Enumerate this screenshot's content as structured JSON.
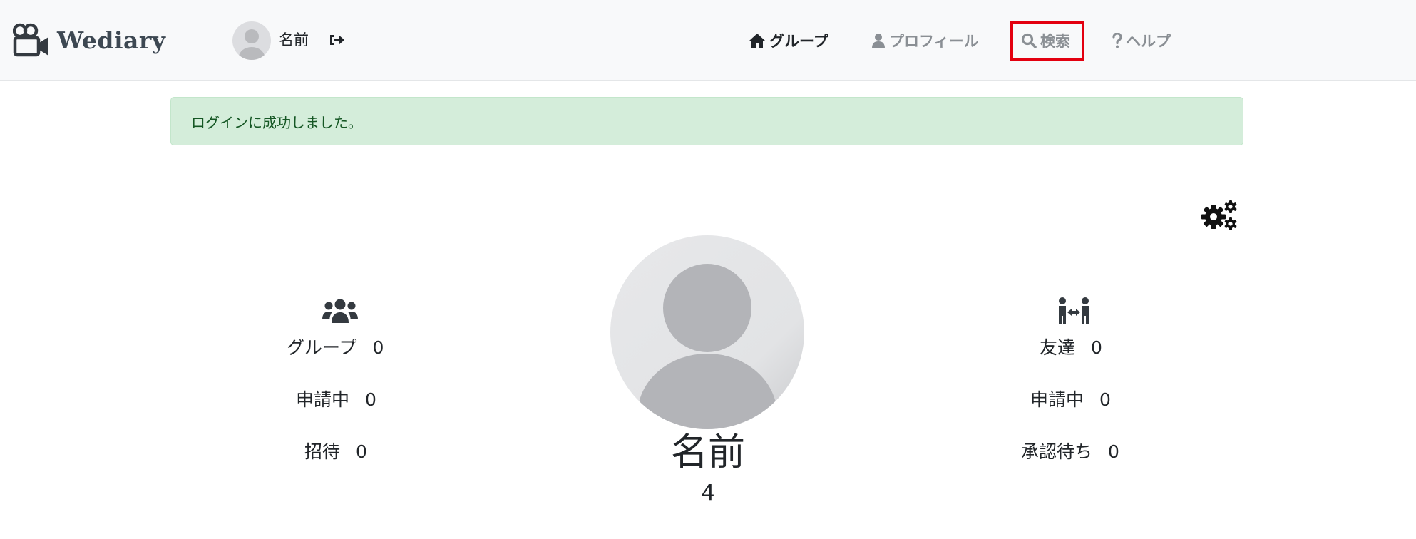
{
  "brand": {
    "name": "Wediary",
    "icon": "video-camera-icon"
  },
  "user": {
    "name": "名前",
    "avatar": "default-avatar",
    "logout_icon": "sign-out-icon"
  },
  "nav": {
    "items": [
      {
        "label": "グループ",
        "icon": "home-icon",
        "active": true
      },
      {
        "label": "プロフィール",
        "icon": "user-icon",
        "active": false
      },
      {
        "label": "検索",
        "icon": "search-icon",
        "active": false,
        "highlighted": true
      },
      {
        "label": "ヘルプ",
        "icon": "question-icon",
        "active": false
      }
    ]
  },
  "alert": {
    "message": "ログインに成功しました。",
    "type": "success",
    "color": "#d4edda"
  },
  "settings": {
    "icon": "gears-icon"
  },
  "left_stats": {
    "icon": "users-icon",
    "items": [
      {
        "label": "グループ",
        "value": "0"
      },
      {
        "label": "申請中",
        "value": "0"
      },
      {
        "label": "招待",
        "value": "0"
      }
    ]
  },
  "right_stats": {
    "icon": "people-arrows-icon",
    "items": [
      {
        "label": "友達",
        "value": "0"
      },
      {
        "label": "申請中",
        "value": "0"
      },
      {
        "label": "承認待ち",
        "value": "0"
      }
    ]
  },
  "profile": {
    "name": "名前",
    "sub": "4",
    "avatar": "default-avatar"
  },
  "colors": {
    "highlight_border": "#e3000f",
    "alert_text": "#155724",
    "navbar_bg": "#f8f9fa"
  }
}
